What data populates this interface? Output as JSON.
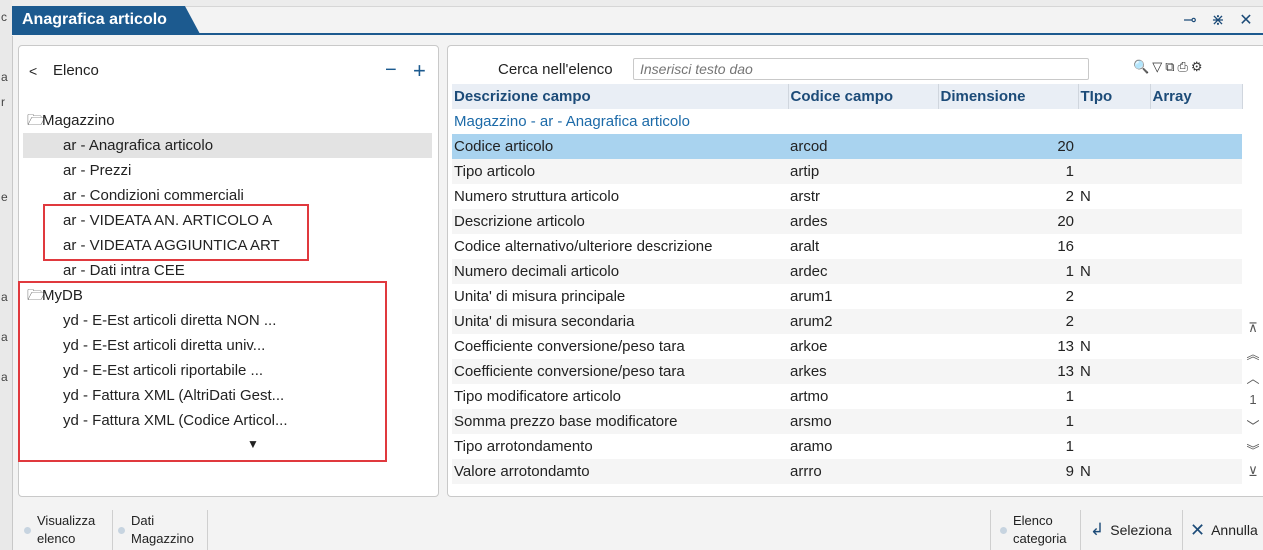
{
  "window": {
    "title": "Anagrafica articolo"
  },
  "left_panel": {
    "title": "Elenco",
    "tree": [
      {
        "type": "folder",
        "label": "Magazzino"
      },
      {
        "type": "child",
        "label": "ar - Anagrafica articolo",
        "selected": true
      },
      {
        "type": "child",
        "label": "ar - Prezzi"
      },
      {
        "type": "child",
        "label": "ar - Condizioni commerciali"
      },
      {
        "type": "child",
        "label": "ar - VIDEATA AN. ARTICOLO A"
      },
      {
        "type": "child",
        "label": "ar - VIDEATA AGGIUNTICA ART"
      },
      {
        "type": "child",
        "label": "ar - Dati intra CEE"
      },
      {
        "type": "folder",
        "label": "MyDB"
      },
      {
        "type": "child",
        "label": "yd - E-Est articoli diretta NON ..."
      },
      {
        "type": "child",
        "label": "yd - E-Est articoli diretta univ..."
      },
      {
        "type": "child",
        "label": "yd - E-Est articoli riportabile ..."
      },
      {
        "type": "child",
        "label": "yd - Fattura XML (AltriDati Gest..."
      },
      {
        "type": "child",
        "label": "yd - Fattura XML (Codice Articol..."
      }
    ]
  },
  "search": {
    "label": "Cerca nell'elenco",
    "placeholder": "Inserisci testo dao"
  },
  "table": {
    "headers": [
      "Descrizione campo",
      "Codice campo",
      "Dimensione",
      "TIpo",
      "Array"
    ],
    "group_label": "Magazzino - ar - Anagrafica articolo",
    "rows": [
      {
        "desc": "Codice articolo",
        "code": "arcod",
        "dim": "20",
        "tipo": "",
        "array": ""
      },
      {
        "desc": "Tipo articolo",
        "code": "artip",
        "dim": "1",
        "tipo": "",
        "array": ""
      },
      {
        "desc": "Numero struttura articolo",
        "code": "arstr",
        "dim": "2",
        "tipo": "N",
        "array": ""
      },
      {
        "desc": "Descrizione articolo",
        "code": "ardes",
        "dim": "20",
        "tipo": "",
        "array": ""
      },
      {
        "desc": "Codice alternativo/ulteriore descrizione",
        "code": "aralt",
        "dim": "16",
        "tipo": "",
        "array": ""
      },
      {
        "desc": "Numero decimali articolo",
        "code": "ardec",
        "dim": "1",
        "tipo": "N",
        "array": ""
      },
      {
        "desc": "Unita' di misura principale",
        "code": "arum1",
        "dim": "2",
        "tipo": "",
        "array": ""
      },
      {
        "desc": "Unita' di misura secondaria",
        "code": "arum2",
        "dim": "2",
        "tipo": "",
        "array": ""
      },
      {
        "desc": "Coefficiente conversione/peso tara",
        "code": "arkoe",
        "dim": "13",
        "tipo": "N",
        "array": ""
      },
      {
        "desc": "Coefficiente conversione/peso tara",
        "code": "arkes",
        "dim": "13",
        "tipo": "N",
        "array": ""
      },
      {
        "desc": "Tipo modificatore articolo",
        "code": "artmo",
        "dim": "1",
        "tipo": "",
        "array": ""
      },
      {
        "desc": "Somma prezzo base modificatore",
        "code": "arsmo",
        "dim": "1",
        "tipo": "",
        "array": ""
      },
      {
        "desc": "Tipo arrotondamento",
        "code": "aramo",
        "dim": "1",
        "tipo": "",
        "array": ""
      },
      {
        "desc": "Valore arrotondamto",
        "code": "arrro",
        "dim": "9",
        "tipo": "N",
        "array": ""
      }
    ]
  },
  "scroll": {
    "page": "1"
  },
  "bottom": {
    "visualizza": [
      "Visualizza",
      "elenco"
    ],
    "dati": [
      "Dati",
      "Magazzino"
    ],
    "elenco_cat": [
      "Elenco",
      "categoria"
    ],
    "seleziona": "Seleziona",
    "annulla": "Annulla"
  },
  "colors": {
    "accent": "#1c5a8f",
    "selection": "#a9d3ef",
    "highlight": "#e0393e"
  },
  "icons": [
    "chevron-left-icon",
    "minus-icon",
    "plus-icon",
    "folder-icon",
    "search-icon",
    "filter-icon",
    "copy-icon",
    "print-icon",
    "settings-icon",
    "pin-icon",
    "collapse-icon",
    "close-icon"
  ]
}
